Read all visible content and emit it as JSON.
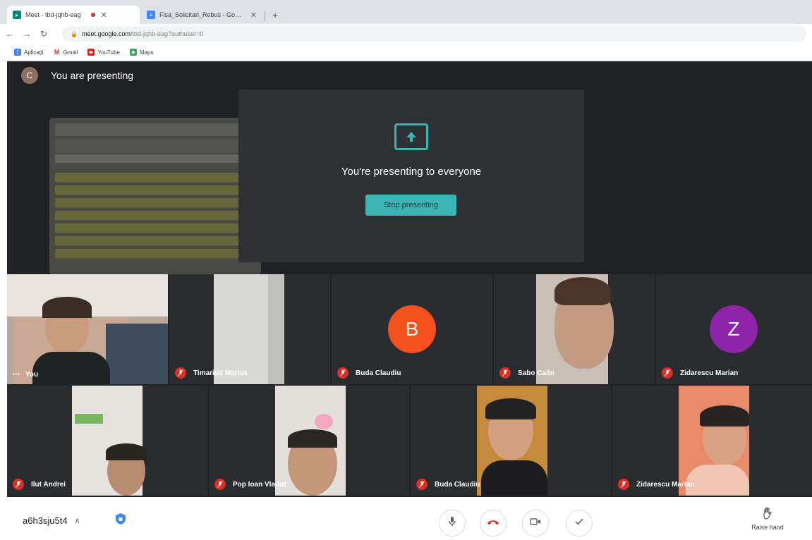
{
  "browser": {
    "tabs": [
      {
        "title": "Meet - tbd-jqhb-eag",
        "active": true
      },
      {
        "title": "Fisa_Solicitari_Rebus - Google Cl",
        "active": false
      }
    ],
    "new_tab": "+",
    "url": {
      "host": "meet.google.com",
      "path": "/tbd-jqhb-eag?authuser=0"
    },
    "bookmarks": [
      {
        "label": "Aplicații",
        "icon": "apps-grid-icon"
      },
      {
        "label": "Gmail",
        "icon": "gmail-icon"
      },
      {
        "label": "YouTube",
        "icon": "youtube-icon"
      },
      {
        "label": "Maps",
        "icon": "maps-icon"
      }
    ]
  },
  "presenting": {
    "avatar_letter": "C",
    "header": "You are presenting",
    "message": "You're presenting to everyone",
    "stop_button": "Stop presenting"
  },
  "participants": [
    {
      "name": "You",
      "kind": "video",
      "muted": false
    },
    {
      "name": "Timariuti Marius",
      "kind": "video",
      "muted": true
    },
    {
      "name": "Buda Claudiu",
      "kind": "avatar",
      "letter": "B",
      "color": "#f4511e",
      "muted": true
    },
    {
      "name": "Sabo Calin",
      "kind": "video",
      "muted": true
    },
    {
      "name": "Zidarescu Marian",
      "kind": "avatar",
      "letter": "Z",
      "color": "#8e24aa",
      "muted": true
    },
    {
      "name": "Ilut Andrei",
      "kind": "video",
      "muted": true
    },
    {
      "name": "Pop Ioan Vladut",
      "kind": "video",
      "muted": true
    },
    {
      "name": "Buda Claudiu",
      "kind": "video",
      "muted": true
    },
    {
      "name": "Zidarescu Marian",
      "kind": "video",
      "muted": true
    }
  ],
  "bottom": {
    "meeting_code": "a6h3sju5t4",
    "raise_hand": "Raise hand"
  },
  "colors": {
    "accent": "#3db4b4",
    "danger": "#d93025",
    "stage": "#202124"
  }
}
